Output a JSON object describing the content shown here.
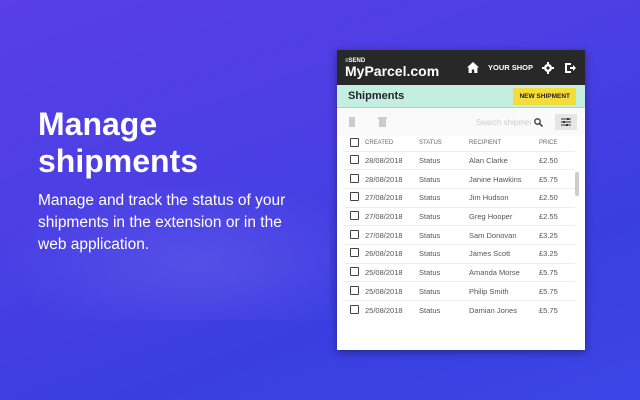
{
  "hero": {
    "title_line1": "Manage",
    "title_line2": "shipments",
    "body": "Manage and track the status of your shipments in the extension or in the web application."
  },
  "app": {
    "logo_small": "≡SEND",
    "logo": "MyParcel.com",
    "shop": "YOUR SHOP",
    "page_title": "Shipments",
    "new_shipment": "NEW SHIPMENT",
    "search_placeholder": "Search shipments"
  },
  "table": {
    "headers": [
      "CREATED",
      "STATUS",
      "RECIPIENT",
      "PRICE"
    ],
    "rows": [
      [
        "28/08/2018",
        "Status",
        "Alan Clarke",
        "£2.50"
      ],
      [
        "28/08/2018",
        "Status",
        "Janine Hawkins",
        "£5.75"
      ],
      [
        "27/08/2018",
        "Status",
        "Jim Hudson",
        "£2.50"
      ],
      [
        "27/08/2018",
        "Status",
        "Greg Hooper",
        "£2.55"
      ],
      [
        "27/08/2018",
        "Status",
        "Sam Donovan",
        "£3.25"
      ],
      [
        "26/08/2018",
        "Status",
        "James Scott",
        "£3.25"
      ],
      [
        "25/08/2018",
        "Status",
        "Amanda Morse",
        "£5.75"
      ],
      [
        "25/08/2018",
        "Status",
        "Philip Smith",
        "£5.75"
      ],
      [
        "25/08/2018",
        "Status",
        "Damian Jones",
        "£5.75"
      ]
    ]
  }
}
